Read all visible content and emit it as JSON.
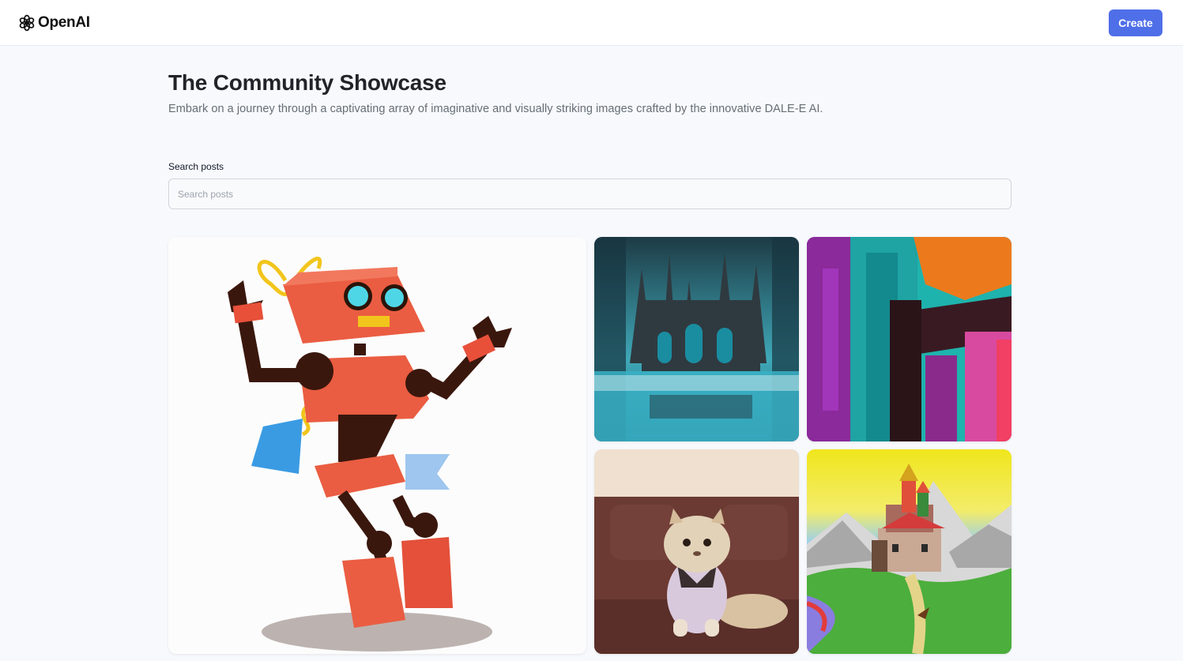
{
  "header": {
    "brand": "OpenAI",
    "create_label": "Create"
  },
  "main": {
    "title": "The Community Showcase",
    "subtitle": "Embark on a journey through a captivating array of imaginative and visually striking images crafted by the innovative DALE-E AI."
  },
  "search": {
    "label": "Search posts",
    "placeholder": "Search posts",
    "value": ""
  },
  "gallery": {
    "items": [
      {
        "subject": "orange-robot-illustration"
      },
      {
        "subject": "gothic-castle-by-lake"
      },
      {
        "subject": "abstract-paint-strokes"
      },
      {
        "subject": "persian-cat-on-sofa"
      },
      {
        "subject": "cartoon-castle-on-hill"
      }
    ]
  },
  "colors": {
    "accent": "#4f6fe8",
    "background": "#f7f9fd",
    "title": "#222328",
    "subtitle": "#666e75"
  }
}
